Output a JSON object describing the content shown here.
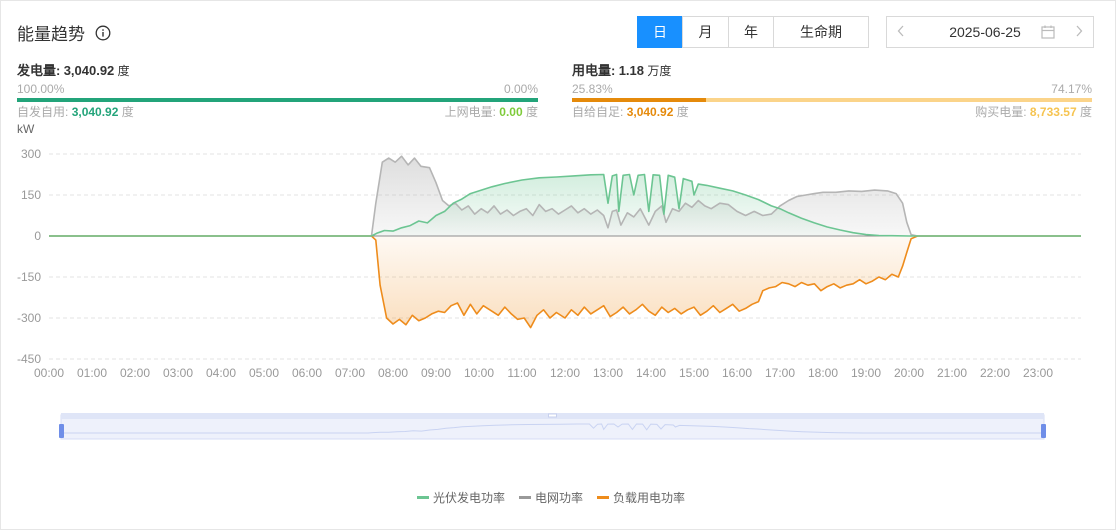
{
  "header": {
    "title": "能量趋势",
    "tabs": [
      {
        "label": "日",
        "active": true
      },
      {
        "label": "月",
        "active": false
      },
      {
        "label": "年",
        "active": false
      },
      {
        "label": "生命期",
        "active": false
      }
    ],
    "date": "2025-06-25"
  },
  "generation": {
    "label": "发电量:",
    "value": "3,040.92",
    "unit": "度",
    "left_pct": "100.00%",
    "right_pct": "0.00%",
    "self_use_label": "自发自用:",
    "self_use_value": "3,040.92",
    "self_use_unit": "度",
    "grid_feed_label": "上网电量:",
    "grid_feed_value": "0.00",
    "grid_feed_unit": "度",
    "self_use_fraction": 1.0
  },
  "consumption": {
    "label": "用电量:",
    "value": "1.18",
    "unit": "万度",
    "left_pct": "25.83%",
    "right_pct": "74.17%",
    "self_supply_label": "自给自足:",
    "self_supply_value": "3,040.92",
    "self_supply_unit": "度",
    "purchase_label": "购买电量:",
    "purchase_value": "8,733.57",
    "purchase_unit": "度",
    "self_supply_fraction": 0.2583
  },
  "colors": {
    "accent": "#1890ff",
    "pv": "#6cc592",
    "pv_bar": "#23a47a",
    "grid": "#b5b5b5",
    "load": "#ee8c1c",
    "load_bar_light": "#fbd48a",
    "self_use_text": "#23a47a",
    "grid_feed_text": "#7ecb3a",
    "self_supply_text": "#e58a0b",
    "purchase_text": "#f6c451"
  },
  "chart_data": {
    "type": "line",
    "ylabel": "kW",
    "ylim": [
      -450,
      300
    ],
    "yticks": [
      300,
      150,
      0,
      -150,
      -300,
      -450
    ],
    "xlim": [
      0,
      24
    ],
    "xticks": [
      "00:00",
      "01:00",
      "02:00",
      "03:00",
      "04:00",
      "05:00",
      "06:00",
      "07:00",
      "08:00",
      "09:00",
      "10:00",
      "11:00",
      "12:00",
      "13:00",
      "14:00",
      "15:00",
      "16:00",
      "17:00",
      "18:00",
      "19:00",
      "20:00",
      "21:00",
      "22:00",
      "23:00"
    ],
    "grid": true,
    "legend_position": "bottom",
    "series": [
      {
        "name": "光伏发电功率",
        "color": "#6cc592",
        "points": [
          [
            0,
            0
          ],
          [
            7.5,
            0
          ],
          [
            7.62,
            10
          ],
          [
            7.8,
            20
          ],
          [
            8.0,
            18
          ],
          [
            8.2,
            30
          ],
          [
            8.4,
            38
          ],
          [
            8.6,
            55
          ],
          [
            8.8,
            48
          ],
          [
            9.0,
            75
          ],
          [
            9.2,
            90
          ],
          [
            9.4,
            120
          ],
          [
            9.6,
            135
          ],
          [
            9.8,
            155
          ],
          [
            10.0,
            165
          ],
          [
            10.3,
            180
          ],
          [
            10.6,
            192
          ],
          [
            11.0,
            205
          ],
          [
            11.4,
            213
          ],
          [
            11.8,
            216
          ],
          [
            12.2,
            220
          ],
          [
            12.6,
            224
          ],
          [
            12.9,
            225
          ],
          [
            13.0,
            120
          ],
          [
            13.1,
            220
          ],
          [
            13.2,
            225
          ],
          [
            13.25,
            90
          ],
          [
            13.35,
            222
          ],
          [
            13.5,
            225
          ],
          [
            13.6,
            150
          ],
          [
            13.7,
            222
          ],
          [
            13.85,
            225
          ],
          [
            13.95,
            90
          ],
          [
            14.05,
            224
          ],
          [
            14.2,
            222
          ],
          [
            14.3,
            80
          ],
          [
            14.4,
            222
          ],
          [
            14.55,
            215
          ],
          [
            14.65,
            100
          ],
          [
            14.75,
            210
          ],
          [
            14.95,
            200
          ],
          [
            15.0,
            150
          ],
          [
            15.1,
            190
          ],
          [
            15.3,
            185
          ],
          [
            15.6,
            175
          ],
          [
            15.9,
            165
          ],
          [
            16.2,
            150
          ],
          [
            16.5,
            133
          ],
          [
            16.8,
            110
          ],
          [
            17.0,
            100
          ],
          [
            17.2,
            85
          ],
          [
            17.5,
            65
          ],
          [
            17.8,
            48
          ],
          [
            18.1,
            33
          ],
          [
            18.4,
            22
          ],
          [
            18.7,
            12
          ],
          [
            19.0,
            5
          ],
          [
            19.3,
            2
          ],
          [
            19.6,
            1
          ],
          [
            20.0,
            0
          ],
          [
            24,
            0
          ]
        ]
      },
      {
        "name": "电网功率",
        "color": "#b5b5b5",
        "points": [
          [
            0,
            0
          ],
          [
            7.5,
            0
          ],
          [
            7.6,
            120
          ],
          [
            7.75,
            270
          ],
          [
            7.9,
            285
          ],
          [
            8.05,
            270
          ],
          [
            8.2,
            292
          ],
          [
            8.35,
            260
          ],
          [
            8.5,
            285
          ],
          [
            8.65,
            255
          ],
          [
            8.85,
            250
          ],
          [
            9.0,
            195
          ],
          [
            9.15,
            130
          ],
          [
            9.3,
            110
          ],
          [
            9.45,
            120
          ],
          [
            9.6,
            95
          ],
          [
            9.75,
            110
          ],
          [
            9.9,
            80
          ],
          [
            10.05,
            100
          ],
          [
            10.2,
            85
          ],
          [
            10.35,
            110
          ],
          [
            10.5,
            80
          ],
          [
            10.65,
            95
          ],
          [
            10.8,
            75
          ],
          [
            10.95,
            90
          ],
          [
            11.1,
            100
          ],
          [
            11.25,
            75
          ],
          [
            11.4,
            115
          ],
          [
            11.55,
            90
          ],
          [
            11.7,
            100
          ],
          [
            11.85,
            80
          ],
          [
            12.0,
            95
          ],
          [
            12.15,
            110
          ],
          [
            12.3,
            85
          ],
          [
            12.45,
            100
          ],
          [
            12.6,
            80
          ],
          [
            12.75,
            95
          ],
          [
            12.9,
            75
          ],
          [
            13.0,
            30
          ],
          [
            13.1,
            90
          ],
          [
            13.2,
            95
          ],
          [
            13.3,
            40
          ],
          [
            13.45,
            85
          ],
          [
            13.6,
            70
          ],
          [
            13.75,
            100
          ],
          [
            13.95,
            40
          ],
          [
            14.1,
            90
          ],
          [
            14.25,
            110
          ],
          [
            14.35,
            50
          ],
          [
            14.5,
            100
          ],
          [
            14.65,
            90
          ],
          [
            14.8,
            120
          ],
          [
            14.95,
            105
          ],
          [
            15.1,
            130
          ],
          [
            15.25,
            110
          ],
          [
            15.4,
            100
          ],
          [
            15.6,
            120
          ],
          [
            15.8,
            115
          ],
          [
            16.0,
            90
          ],
          [
            16.2,
            75
          ],
          [
            16.4,
            90
          ],
          [
            16.6,
            75
          ],
          [
            16.8,
            80
          ],
          [
            17.0,
            110
          ],
          [
            17.2,
            130
          ],
          [
            17.4,
            145
          ],
          [
            17.6,
            150
          ],
          [
            17.8,
            155
          ],
          [
            18.0,
            160
          ],
          [
            18.3,
            160
          ],
          [
            18.6,
            165
          ],
          [
            18.9,
            163
          ],
          [
            19.2,
            168
          ],
          [
            19.5,
            165
          ],
          [
            19.7,
            155
          ],
          [
            19.85,
            120
          ],
          [
            19.95,
            50
          ],
          [
            20.05,
            5
          ],
          [
            20.2,
            0
          ],
          [
            24,
            0
          ]
        ]
      },
      {
        "name": "负载用电功率",
        "color": "#ee8c1c",
        "points": [
          [
            0,
            0
          ],
          [
            7.5,
            0
          ],
          [
            7.6,
            -15
          ],
          [
            7.7,
            -180
          ],
          [
            7.85,
            -300
          ],
          [
            8.0,
            -322
          ],
          [
            8.15,
            -305
          ],
          [
            8.3,
            -325
          ],
          [
            8.45,
            -290
          ],
          [
            8.6,
            -310
          ],
          [
            8.75,
            -300
          ],
          [
            8.9,
            -285
          ],
          [
            9.05,
            -275
          ],
          [
            9.2,
            -280
          ],
          [
            9.35,
            -255
          ],
          [
            9.5,
            -245
          ],
          [
            9.65,
            -290
          ],
          [
            9.8,
            -250
          ],
          [
            9.95,
            -285
          ],
          [
            10.1,
            -255
          ],
          [
            10.3,
            -275
          ],
          [
            10.45,
            -290
          ],
          [
            10.6,
            -260
          ],
          [
            10.75,
            -285
          ],
          [
            10.9,
            -305
          ],
          [
            11.05,
            -300
          ],
          [
            11.2,
            -335
          ],
          [
            11.35,
            -290
          ],
          [
            11.5,
            -270
          ],
          [
            11.65,
            -300
          ],
          [
            11.8,
            -280
          ],
          [
            12.0,
            -300
          ],
          [
            12.15,
            -270
          ],
          [
            12.3,
            -290
          ],
          [
            12.45,
            -260
          ],
          [
            12.6,
            -285
          ],
          [
            12.75,
            -270
          ],
          [
            12.9,
            -255
          ],
          [
            13.05,
            -295
          ],
          [
            13.2,
            -280
          ],
          [
            13.35,
            -260
          ],
          [
            13.5,
            -285
          ],
          [
            13.65,
            -270
          ],
          [
            13.8,
            -250
          ],
          [
            13.95,
            -275
          ],
          [
            14.1,
            -290
          ],
          [
            14.25,
            -260
          ],
          [
            14.4,
            -280
          ],
          [
            14.55,
            -265
          ],
          [
            14.7,
            -285
          ],
          [
            14.85,
            -270
          ],
          [
            15.0,
            -260
          ],
          [
            15.15,
            -290
          ],
          [
            15.3,
            -275
          ],
          [
            15.45,
            -255
          ],
          [
            15.6,
            -280
          ],
          [
            15.75,
            -265
          ],
          [
            15.9,
            -250
          ],
          [
            16.05,
            -275
          ],
          [
            16.2,
            -265
          ],
          [
            16.35,
            -250
          ],
          [
            16.5,
            -240
          ],
          [
            16.6,
            -200
          ],
          [
            16.75,
            -190
          ],
          [
            16.9,
            -185
          ],
          [
            17.05,
            -170
          ],
          [
            17.2,
            -175
          ],
          [
            17.35,
            -185
          ],
          [
            17.5,
            -170
          ],
          [
            17.65,
            -180
          ],
          [
            17.8,
            -175
          ],
          [
            17.95,
            -200
          ],
          [
            18.1,
            -185
          ],
          [
            18.25,
            -175
          ],
          [
            18.4,
            -190
          ],
          [
            18.55,
            -180
          ],
          [
            18.7,
            -175
          ],
          [
            18.85,
            -160
          ],
          [
            19.0,
            -175
          ],
          [
            19.15,
            -165
          ],
          [
            19.3,
            -150
          ],
          [
            19.45,
            -160
          ],
          [
            19.6,
            -140
          ],
          [
            19.75,
            -150
          ],
          [
            19.85,
            -110
          ],
          [
            19.95,
            -60
          ],
          [
            20.05,
            -10
          ],
          [
            20.2,
            0
          ],
          [
            24,
            0
          ]
        ]
      }
    ]
  }
}
